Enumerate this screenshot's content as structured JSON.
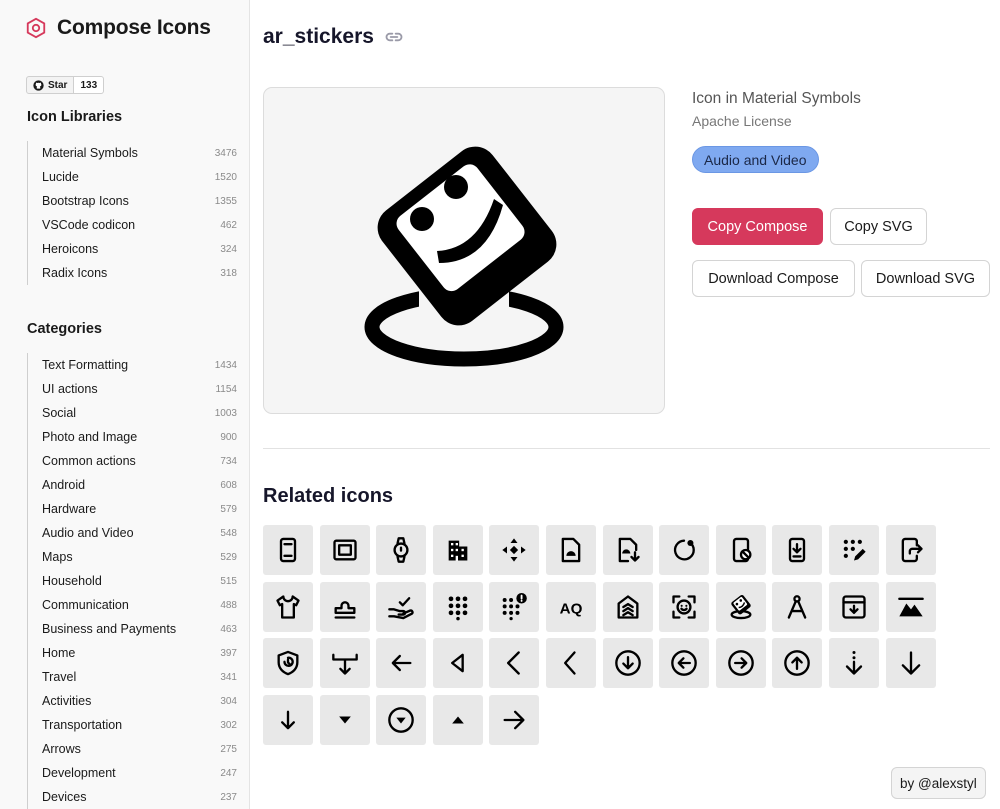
{
  "app": {
    "name": "Compose Icons"
  },
  "github": {
    "star_label": "Star",
    "count": "133"
  },
  "sidebar": {
    "libraries_title": "Icon Libraries",
    "libraries": [
      {
        "label": "Material Symbols",
        "count": "3476"
      },
      {
        "label": "Lucide",
        "count": "1520"
      },
      {
        "label": "Bootstrap Icons",
        "count": "1355"
      },
      {
        "label": "VSCode codicon",
        "count": "462"
      },
      {
        "label": "Heroicons",
        "count": "324"
      },
      {
        "label": "Radix Icons",
        "count": "318"
      }
    ],
    "categories_title": "Categories",
    "categories": [
      {
        "label": "Text Formatting",
        "count": "1434"
      },
      {
        "label": "UI actions",
        "count": "1154"
      },
      {
        "label": "Social",
        "count": "1003"
      },
      {
        "label": "Photo and Image",
        "count": "900"
      },
      {
        "label": "Common actions",
        "count": "734"
      },
      {
        "label": "Android",
        "count": "608"
      },
      {
        "label": "Hardware",
        "count": "579"
      },
      {
        "label": "Audio and Video",
        "count": "548"
      },
      {
        "label": "Maps",
        "count": "529"
      },
      {
        "label": "Household",
        "count": "515"
      },
      {
        "label": "Communication",
        "count": "488"
      },
      {
        "label": "Business and Payments",
        "count": "463"
      },
      {
        "label": "Home",
        "count": "397"
      },
      {
        "label": "Travel",
        "count": "341"
      },
      {
        "label": "Activities",
        "count": "304"
      },
      {
        "label": "Transportation",
        "count": "302"
      },
      {
        "label": "Arrows",
        "count": "275"
      },
      {
        "label": "Development",
        "count": "247"
      },
      {
        "label": "Devices",
        "count": "237"
      }
    ]
  },
  "icon": {
    "name": "ar_stickers",
    "library_line": "Icon in Material Symbols",
    "license": "Apache License",
    "category_chip": "Audio and Video"
  },
  "actions": {
    "copy_compose": "Copy Compose",
    "copy_svg": "Copy SVG",
    "download_compose": "Download Compose",
    "download_svg": "Download SVG"
  },
  "related": {
    "title": "Related icons",
    "icons": [
      "smartphone-icon",
      "pageless-icon",
      "watch-icon",
      "apartment-icon",
      "move-icon",
      "android-doc-icon",
      "doc-download-icon",
      "progress-icon",
      "phonelink-erase-icon",
      "install-mobile-icon",
      "dialpad-edit-icon",
      "app-shortcut-icon",
      "tshirt-icon",
      "stamp-icon",
      "hand-check-icon",
      "dialpad-icon",
      "dialpad-alert-icon",
      "text-aq-icon",
      "home-stack-icon",
      "face-scan-icon",
      "ar-stickers-icon",
      "compass-tool-icon",
      "archive-download-icon",
      "landscape-icon",
      "shield-clock-icon",
      "move-down-icon",
      "arrow-left-icon",
      "triangle-left-icon",
      "chevron-left-icon",
      "chevron-left-thin-icon",
      "arrow-circle-down-icon",
      "arrow-circle-left-icon",
      "arrow-circle-right-icon",
      "arrow-circle-up-icon",
      "arrow-down-dotted-icon",
      "arrow-down-icon",
      "arrow-down-small-icon",
      "caret-down-icon",
      "caret-circle-down-icon",
      "caret-up-icon",
      "arrow-right-icon"
    ]
  },
  "credit": {
    "text": "by @alexstyl"
  },
  "colors": {
    "accent": "#d6395c",
    "chip": "#7fa9f0",
    "tile": "#e8e8e8"
  }
}
